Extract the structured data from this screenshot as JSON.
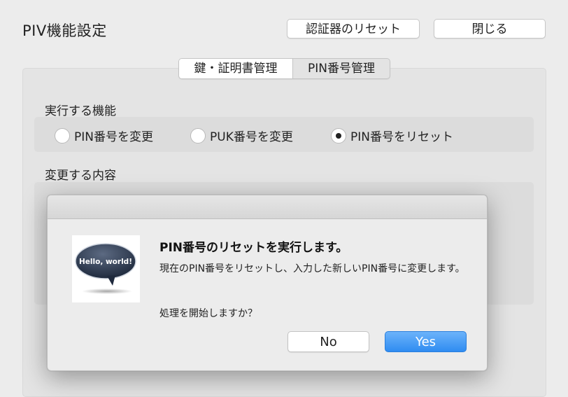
{
  "window": {
    "title": "PIV機能設定",
    "reset_button": "認証器のリセット",
    "close_button": "閉じる"
  },
  "tabs": [
    {
      "label": "鍵・証明書管理",
      "active": true
    },
    {
      "label": "PIN番号管理",
      "active": false
    }
  ],
  "function_section": {
    "label": "実行する機能",
    "options": [
      {
        "label": "PIN番号を変更",
        "checked": false
      },
      {
        "label": "PUK番号を変更",
        "checked": false
      },
      {
        "label": "PIN番号をリセット",
        "checked": true
      }
    ]
  },
  "change_section": {
    "label": "変更する内容"
  },
  "dialog": {
    "icon_text": "Hello, world!",
    "title": "PIN番号のリセットを実行します。",
    "message": "現在のPIN番号をリセットし、入力した新しいPIN番号に変更します。",
    "question": "処理を開始しますか？",
    "no_button": "No",
    "yes_button": "Yes",
    "accent_color": "#2f8cf1"
  }
}
